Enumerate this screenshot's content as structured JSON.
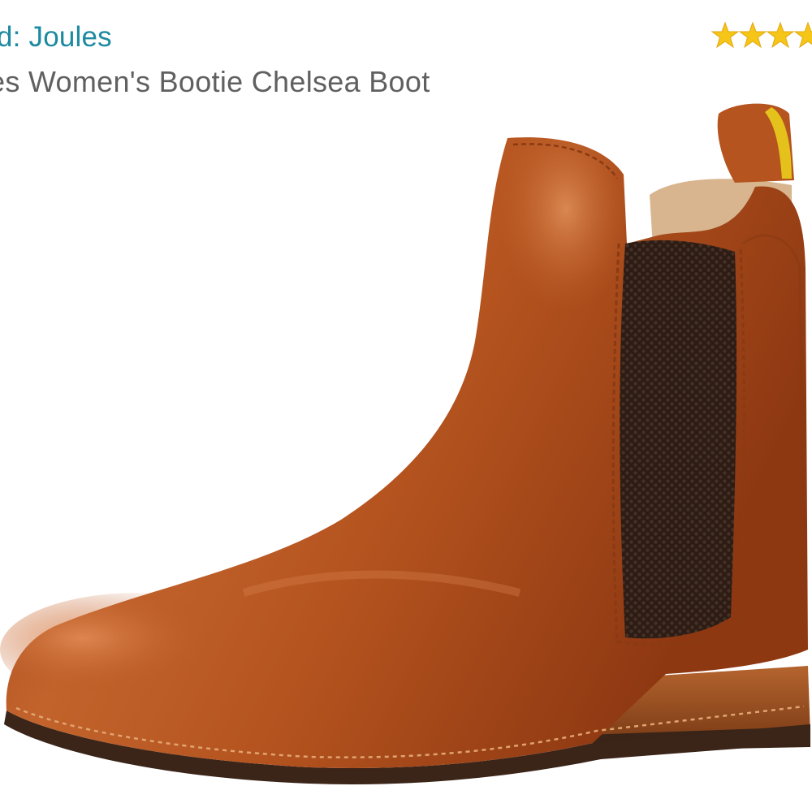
{
  "header": {
    "brand_link": "d: Joules",
    "product_title": "es Women's Bootie Chelsea Boot"
  },
  "rating": {
    "stars_visible": 3.5,
    "star_color": "#f5c518"
  },
  "image": {
    "icon": "chelsea-boot-image",
    "leather_color": "#b5541f",
    "elastic_color": "#2c1c14",
    "pull_tab_lining_color": "#e5c21b"
  }
}
